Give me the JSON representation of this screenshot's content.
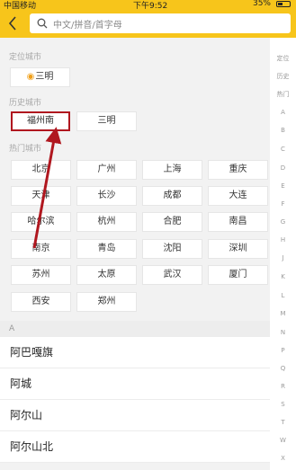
{
  "status_bar": {
    "carrier": "中国移动",
    "time": "下午9:52",
    "battery": "35%"
  },
  "header": {
    "search_placeholder": "中文/拼音/首字母"
  },
  "location": {
    "title": "定位城市",
    "city": "三明"
  },
  "history": {
    "title": "历史城市",
    "cities": [
      "福州南",
      "三明"
    ]
  },
  "hot": {
    "title": "热门城市",
    "rows": [
      [
        "北京",
        "广州",
        "上海",
        "重庆"
      ],
      [
        "天津",
        "长沙",
        "成都",
        "大连"
      ],
      [
        "哈尔滨",
        "杭州",
        "合肥",
        "南昌"
      ],
      [
        "南京",
        "青岛",
        "沈阳",
        "深圳"
      ],
      [
        "苏州",
        "太原",
        "武汉",
        "厦门"
      ],
      [
        "西安",
        "郑州"
      ]
    ]
  },
  "list": {
    "letter": "A",
    "cities": [
      "阿巴嘎旗",
      "阿城",
      "阿尔山",
      "阿尔山北"
    ]
  },
  "index": [
    "定位",
    "历史",
    "热门",
    "A",
    "B",
    "C",
    "D",
    "E",
    "F",
    "G",
    "H",
    "J",
    "K",
    "L",
    "M",
    "N",
    "P",
    "Q",
    "R",
    "S",
    "T",
    "W",
    "X"
  ],
  "colors": {
    "header": "#f7c51b",
    "highlight": "#b0171f",
    "pin": "#f0a01a"
  }
}
